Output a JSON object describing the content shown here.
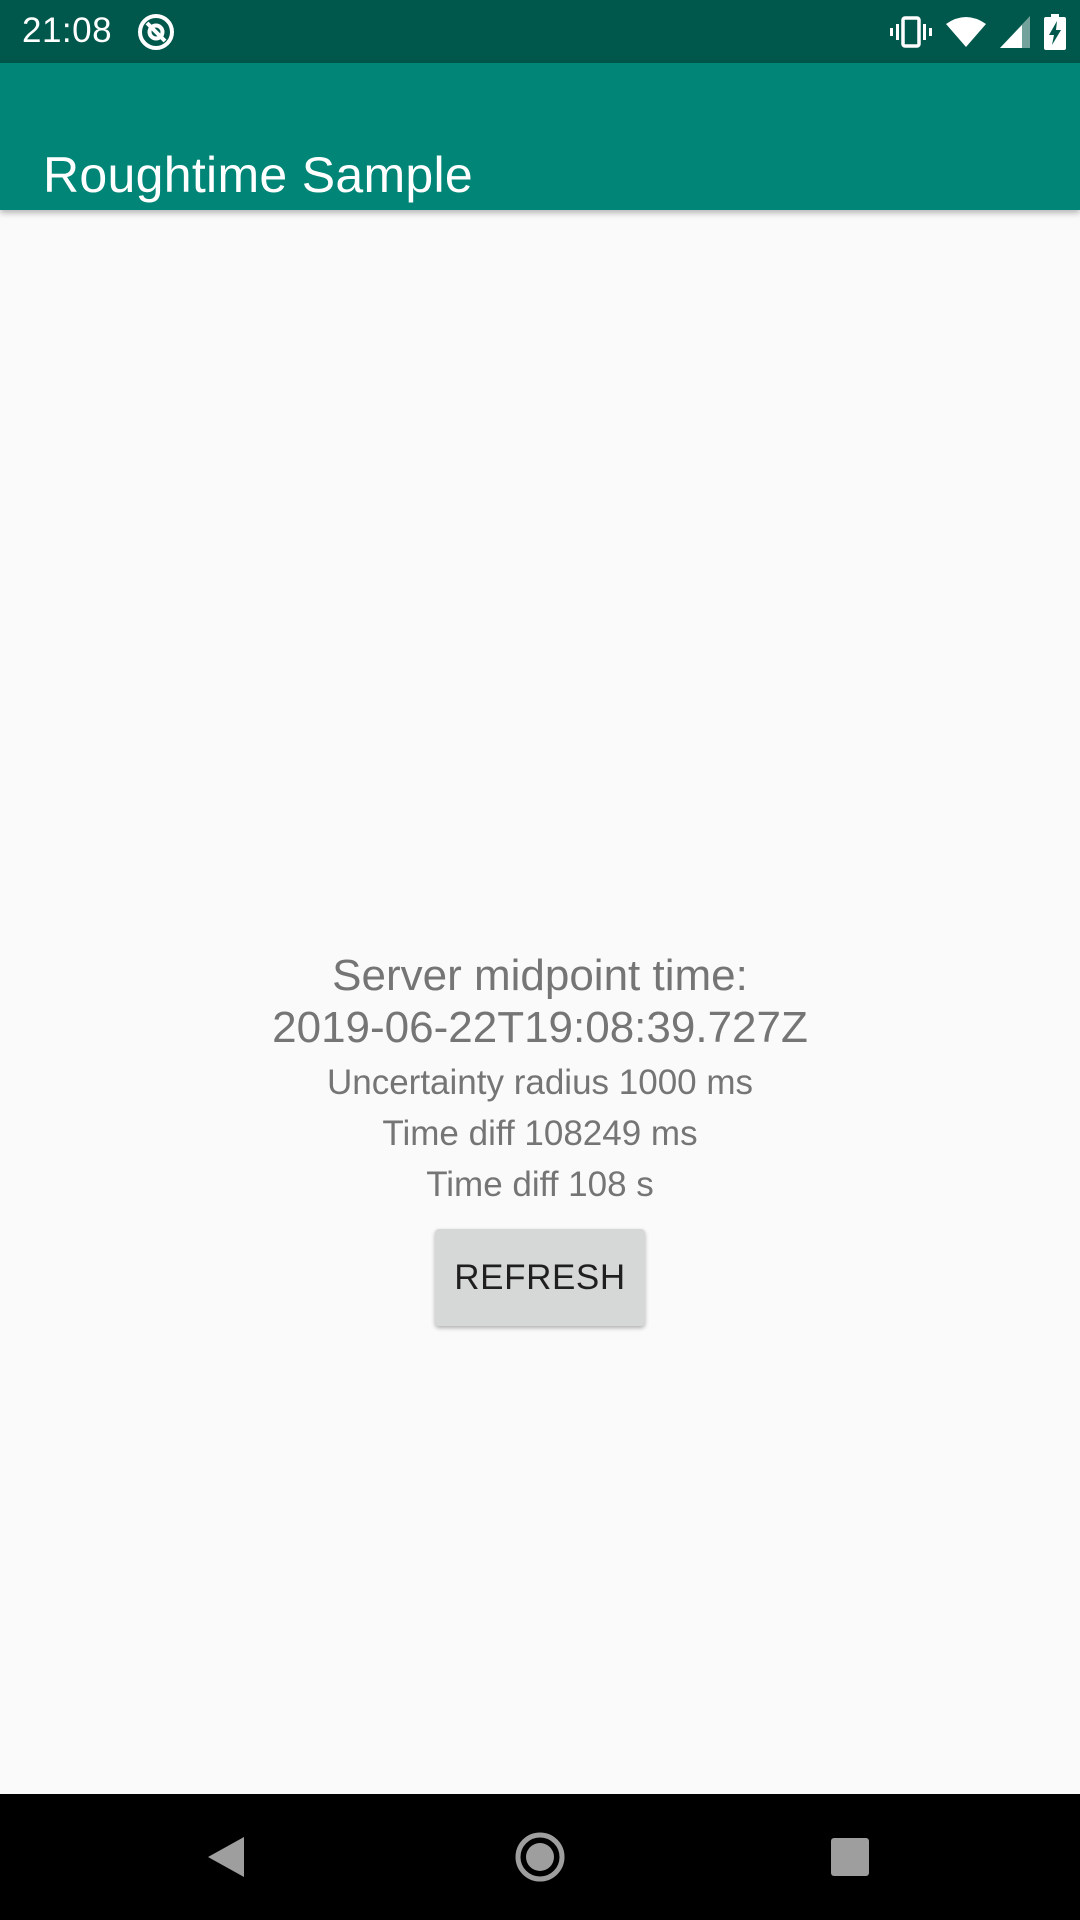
{
  "status_bar": {
    "time": "21:08",
    "icons": [
      "at-sign-icon",
      "vibrate-icon",
      "wifi-icon",
      "signal-icon",
      "battery-charging-icon"
    ]
  },
  "app_bar": {
    "title": "Roughtime Sample",
    "color": "#008577"
  },
  "main": {
    "midpoint_label": "Server midpoint time:",
    "midpoint_value": "2019-06-22T19:08:39.727Z",
    "uncertainty_text": "Uncertainty radius  1000 ms",
    "time_diff_ms_text": "Time diff 108249 ms",
    "time_diff_s_text": "Time diff 108 s",
    "refresh_label": "REFRESH"
  },
  "nav_bar": {
    "icons": [
      "back-icon",
      "home-icon",
      "recents-icon"
    ]
  },
  "colors": {
    "status_bar": "#00574b",
    "app_bar": "#008577",
    "background": "#fafafa",
    "text_secondary": "#757575",
    "button": "#d6d7d7"
  }
}
